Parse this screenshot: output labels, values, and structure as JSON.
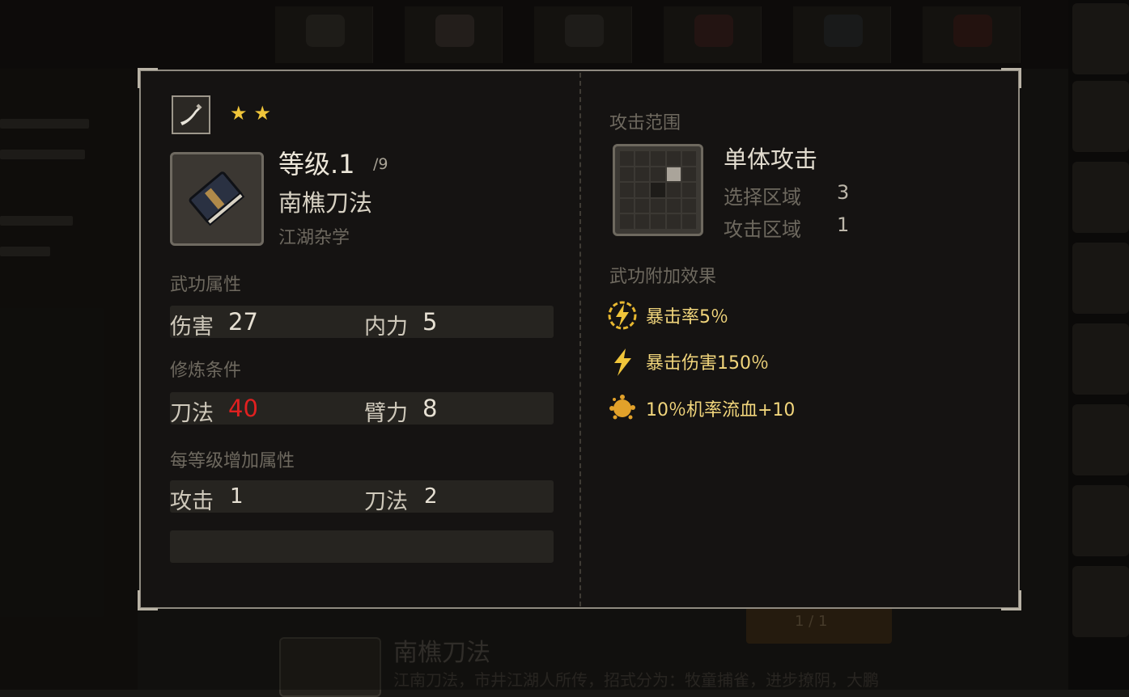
{
  "background": {
    "bottom_title": "南樵刀法",
    "bottom_desc": "江南刀法，市井江湖人所传，招式分为：牧童捕雀，进步撩阴，大鹏",
    "bottom_button": "1 / 1"
  },
  "skill": {
    "stars": [
      "★",
      "★"
    ],
    "level": "等级.1",
    "level_max": "/9",
    "name": "南樵刀法",
    "category": "江湖杂学"
  },
  "attributes": {
    "title": "武功属性",
    "damage_label": "伤害",
    "damage_value": "27",
    "neili_label": "内力",
    "neili_value": "5"
  },
  "requirements": {
    "title": "修炼条件",
    "blade_label": "刀法",
    "blade_value": "40",
    "arm_label": "臂力",
    "arm_value": "8"
  },
  "per_level": {
    "title": "每等级增加属性",
    "attack_label": "攻击",
    "attack_value": "1",
    "blade_label": "刀法",
    "blade_value": "2"
  },
  "range": {
    "title": "攻击范围",
    "type": "单体攻击",
    "select_label": "选择区域",
    "select_value": "3",
    "attack_label": "攻击区域",
    "attack_value": "1"
  },
  "effects": {
    "title": "武功附加效果",
    "items": [
      {
        "text": "暴击率5％",
        "icon": "lightning-circle-icon"
      },
      {
        "text": "暴击伤害150％",
        "icon": "lightning-icon"
      },
      {
        "text": "10％机率流血+10",
        "icon": "blood-splash-icon"
      }
    ]
  },
  "colors": {
    "requirement_unmet": "#e02020",
    "effect_text": "#f2d67c",
    "star": "#f0c53a"
  }
}
